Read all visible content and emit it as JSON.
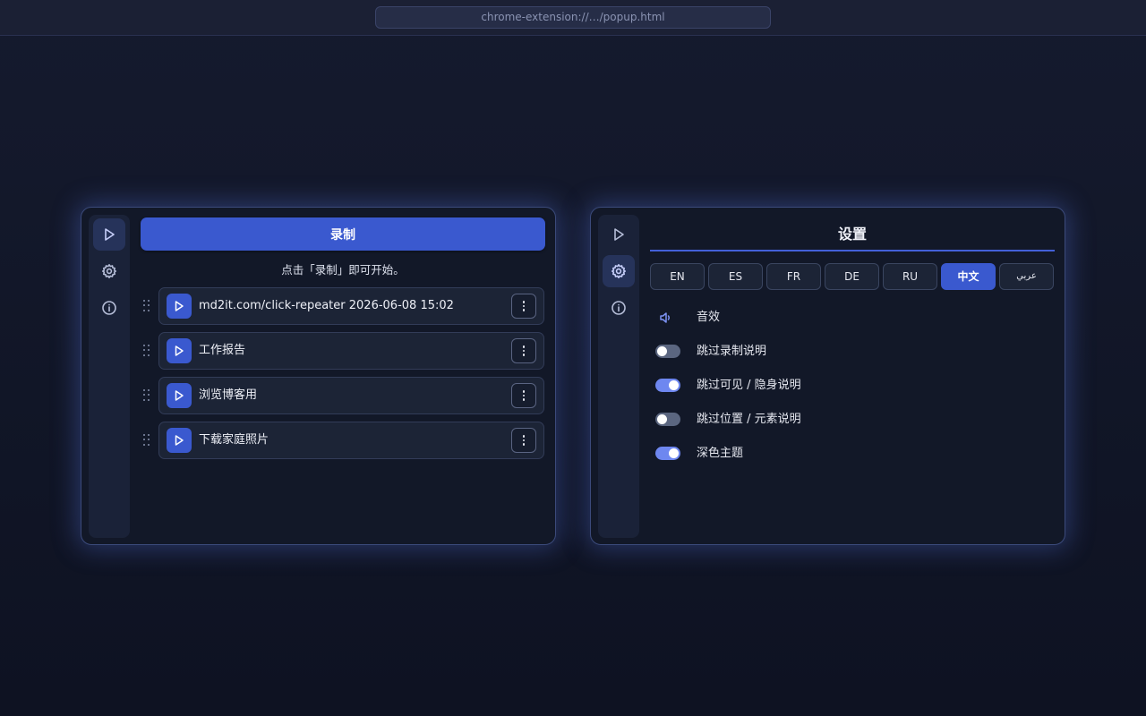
{
  "browser": {
    "url": "chrome-extension://…/popup.html"
  },
  "colors": {
    "accent": "#3a59cf",
    "toggle_on": "#6e87f0",
    "toggle_off": "#5b6680",
    "background": "#111627"
  },
  "left_panel": {
    "rail": [
      {
        "icon": "play-icon",
        "active": true
      },
      {
        "icon": "gear-icon",
        "active": false
      },
      {
        "icon": "info-icon",
        "active": false
      }
    ],
    "record_label": "录制",
    "hint": "点击「录制」即可开始。",
    "items": [
      {
        "label": "md2it.com/click-repeater 2026-06-08 15:02"
      },
      {
        "label": "工作报告"
      },
      {
        "label": "浏览博客用"
      },
      {
        "label": "下载家庭照片"
      }
    ]
  },
  "right_panel": {
    "rail": [
      {
        "icon": "play-icon",
        "active": false
      },
      {
        "icon": "gear-icon",
        "active": true
      },
      {
        "icon": "info-icon",
        "active": false
      }
    ],
    "title": "设置",
    "languages": [
      "EN",
      "ES",
      "FR",
      "DE",
      "RU",
      "中文",
      "عربي"
    ],
    "selected_language": "中文",
    "settings": [
      {
        "label": "音效",
        "control": "sound-icon"
      },
      {
        "label": "跳过录制说明",
        "control": "toggle",
        "on": false
      },
      {
        "label": "跳过可见 / 隐身说明",
        "control": "toggle",
        "on": true
      },
      {
        "label": "跳过位置 / 元素说明",
        "control": "toggle",
        "on": false
      },
      {
        "label": "深色主题",
        "control": "toggle",
        "on": true
      }
    ]
  }
}
